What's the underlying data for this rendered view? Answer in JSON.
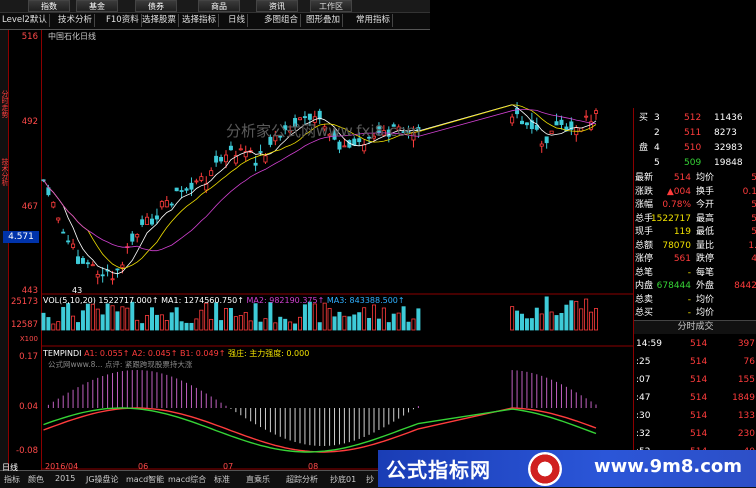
{
  "topmenu": [
    "指数",
    "基金",
    "债券",
    "商品",
    "资讯",
    "工作区"
  ],
  "toolbar": [
    "Level2默认",
    "技术分析",
    "F10资料",
    "选择股票",
    "选择指标",
    "日线",
    "多图组合",
    "图形叠加",
    "常用指标"
  ],
  "leftstrip": [
    "分时走势",
    "技术分析"
  ],
  "chart": {
    "title": "中国石化日线",
    "y_labels": [
      "516",
      "492",
      "467",
      "443"
    ],
    "current_price_box": "4.571",
    "low_marker": "43",
    "watermark": "分析家公式网www.fxj8.com",
    "vol_header": [
      "VOL(5,10,20)",
      "1522717.000↑",
      "MA1: 1274560.750↑",
      "MA2: 982190.375↑",
      "MA3: 843388.500↑"
    ],
    "vol_labels": [
      "25173",
      "12587",
      "X100"
    ],
    "ind_header": [
      "TEMPINDI",
      "A1: 0.055↑",
      "A2: 0.045↑",
      "B1: 0.049↑",
      "强庄: 主力强度: 0.000"
    ],
    "ind_sub": "公式网www.8... 点评: 紧跟跨现股票持大涨",
    "ind_labels": [
      "0.17",
      "0.04",
      "-0.08"
    ]
  },
  "order_book": {
    "sell": [
      {
        "n": "3",
        "p": "512",
        "v": "11436"
      },
      {
        "n": "2",
        "p": "511",
        "v": "8273"
      },
      {
        "n": "4",
        "p": "510",
        "v": "32983"
      },
      {
        "n": "5",
        "p": "509",
        "v": "19848"
      }
    ],
    "sell_label_1": "买",
    "sell_label_2": "盘"
  },
  "quote": [
    {
      "l": "最新",
      "v": "514",
      "l2": "均价",
      "v2": "5"
    },
    {
      "l": "涨跌",
      "v": "▲004",
      "l2": "换手",
      "v2": "0.1"
    },
    {
      "l": "涨幅",
      "v": "0.78%",
      "l2": "今开",
      "v2": "5"
    },
    {
      "l": "总手",
      "v": "1522717",
      "l2": "最高",
      "v2": "5"
    },
    {
      "l": "现手",
      "v": "119",
      "l2": "最低",
      "v2": "5"
    },
    {
      "l": "总额",
      "v": "78070",
      "l2": "量比",
      "v2": "1."
    },
    {
      "l": "涨停",
      "v": "561",
      "l2": "跌停",
      "v2": "4"
    },
    {
      "l": "总笔",
      "v": "-",
      "l2": "每笔",
      "v2": ""
    },
    {
      "l": "内盘",
      "v": "678444",
      "l2": "外盘",
      "v2": "8442"
    },
    {
      "l": "总卖",
      "v": "-",
      "l2": "均价",
      "v2": ""
    },
    {
      "l": "总买",
      "v": "-",
      "l2": "均价",
      "v2": ""
    }
  ],
  "ticks_title": "分时成交",
  "ticks": [
    {
      "t": "14:59",
      "p": "514",
      "v": "397"
    },
    {
      "t": ":25",
      "p": "514",
      "v": "76"
    },
    {
      "t": ":07",
      "p": "514",
      "v": "155"
    },
    {
      "t": ":47",
      "p": "514",
      "v": "1849"
    },
    {
      "t": ":30",
      "p": "514",
      "v": "133"
    },
    {
      "t": ":32",
      "p": "514",
      "v": "230"
    },
    {
      "t": ":52",
      "p": "514",
      "v": "40"
    }
  ],
  "bottom_axis": [
    "日线",
    "2016/04",
    "06",
    "07",
    "08"
  ],
  "bottom_tabs": [
    "指标",
    "颜色",
    "2015",
    "JG操盘论",
    "macd智能",
    "macd综合",
    "标准",
    "直乘乐",
    "超踪分析",
    "抄底01",
    "抄"
  ],
  "banner": {
    "left": "公式指标网",
    "right": "www.9m8.com"
  },
  "colors": {
    "up": "#ff3c3c",
    "down": "#36d336",
    "ma": "#ffffff",
    "accent": "#f0e000"
  }
}
